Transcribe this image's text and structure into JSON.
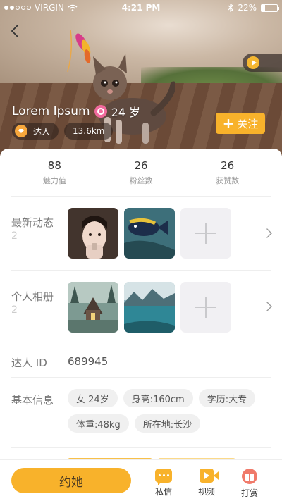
{
  "status_bar": {
    "carrier": "VIRGIN",
    "time": "4:21 PM",
    "battery": "22%",
    "battery_level": 0.22
  },
  "profile": {
    "name": "Lorem Ipsum",
    "age": "24 岁",
    "tags": [
      "达人",
      "13.6km"
    ],
    "follow_label": "关注"
  },
  "stats": [
    {
      "value": "88",
      "label": "魅力值"
    },
    {
      "value": "26",
      "label": "粉丝数"
    },
    {
      "value": "26",
      "label": "获赞数"
    }
  ],
  "sections": {
    "moments": {
      "title": "最新动态",
      "count": "2"
    },
    "album": {
      "title": "个人相册",
      "count": "2"
    },
    "talent_id": {
      "title": "达人 ID",
      "value": "689945"
    },
    "basic_info": {
      "title": "基本信息",
      "chips": [
        "女 24岁",
        "身高:160cm",
        "学历:大专",
        "体重:48kg",
        "所在地:长沙"
      ]
    }
  },
  "bottom_bar": {
    "date_label": "约她",
    "actions": [
      "私信",
      "视频",
      "打赏"
    ]
  },
  "colors": {
    "accent": "#f8b22b",
    "gender_female": "#f06a9c",
    "gift": "#f07a6a"
  },
  "icons": [
    "back-arrow-icon",
    "play-icon",
    "female-icon",
    "diamond-icon",
    "plus-icon",
    "chevron-right-icon",
    "message-icon",
    "video-icon",
    "gift-icon",
    "wifi-icon",
    "bluetooth-icon",
    "battery-icon"
  ]
}
